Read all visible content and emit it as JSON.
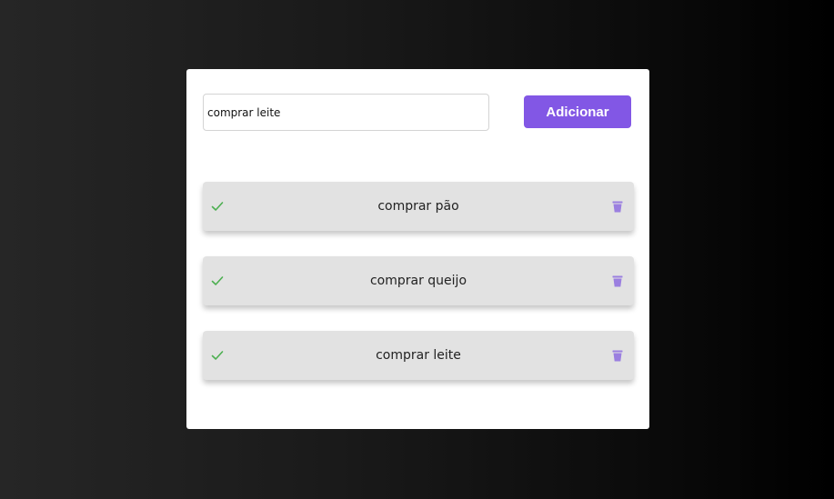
{
  "form": {
    "input_value": "comprar leite",
    "add_label": "Adicionar"
  },
  "tasks": [
    {
      "label": "comprar pão"
    },
    {
      "label": "comprar queijo"
    },
    {
      "label": "comprar leite"
    }
  ],
  "colors": {
    "accent": "#8257e5",
    "check": "#4caf50",
    "trash": "#9b7fe0",
    "item_bg": "#e2e2e2"
  },
  "icons": {
    "complete": "check-icon",
    "delete": "trash-icon"
  }
}
